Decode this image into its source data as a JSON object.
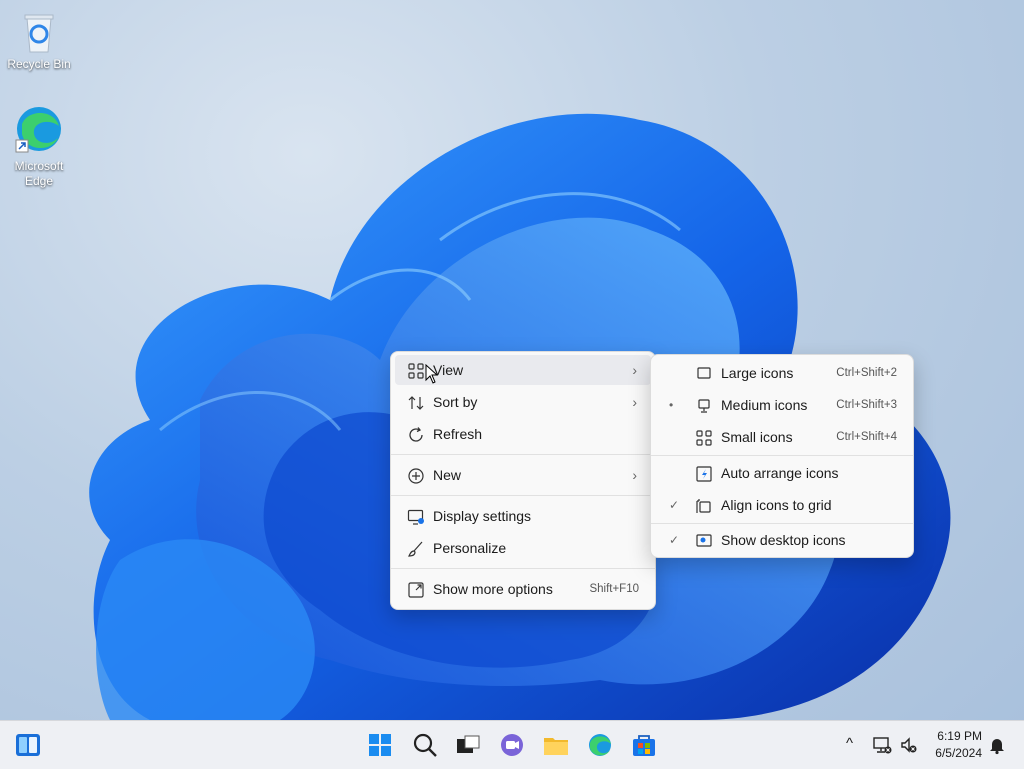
{
  "desktop": {
    "icons": [
      {
        "label": "Recycle Bin",
        "icon": "recycle-bin-icon"
      },
      {
        "label": "Microsoft Edge",
        "icon": "edge-icon"
      }
    ]
  },
  "context_menu": {
    "items": [
      {
        "label": "View",
        "icon": "grid-icon",
        "has_submenu": true
      },
      {
        "label": "Sort by",
        "icon": "sort-icon",
        "has_submenu": true
      },
      {
        "label": "Refresh",
        "icon": "refresh-icon"
      },
      {
        "label": "New",
        "icon": "plus-circle-icon",
        "has_submenu": true
      },
      {
        "label": "Display settings",
        "icon": "display-settings-icon"
      },
      {
        "label": "Personalize",
        "icon": "brush-icon"
      },
      {
        "label": "Show more options",
        "icon": "more-options-icon",
        "shortcut": "Shift+F10"
      }
    ],
    "arrow": "›"
  },
  "view_submenu": {
    "items": [
      {
        "label": "Large icons",
        "shortcut": "Ctrl+Shift+2",
        "icon": "monitor-icon"
      },
      {
        "label": "Medium icons",
        "shortcut": "Ctrl+Shift+3",
        "icon": "monitor-stand-icon",
        "mark": "•"
      },
      {
        "label": "Small icons",
        "shortcut": "Ctrl+Shift+4",
        "icon": "small-grid-icon"
      },
      {
        "label": "Auto arrange icons",
        "icon": "auto-arrange-icon"
      },
      {
        "label": "Align icons to grid",
        "icon": "align-grid-icon",
        "mark": "✓"
      },
      {
        "label": "Show desktop icons",
        "icon": "show-desktop-icon",
        "mark": "✓"
      }
    ]
  },
  "taskbar": {
    "apps": [
      "start-icon",
      "search-icon",
      "task-view-icon",
      "teams-chat-icon",
      "file-explorer-icon",
      "edge-icon",
      "store-icon"
    ],
    "tray": {
      "chevron": "^",
      "time": "6:19 PM",
      "date": "6/5/2024"
    }
  }
}
